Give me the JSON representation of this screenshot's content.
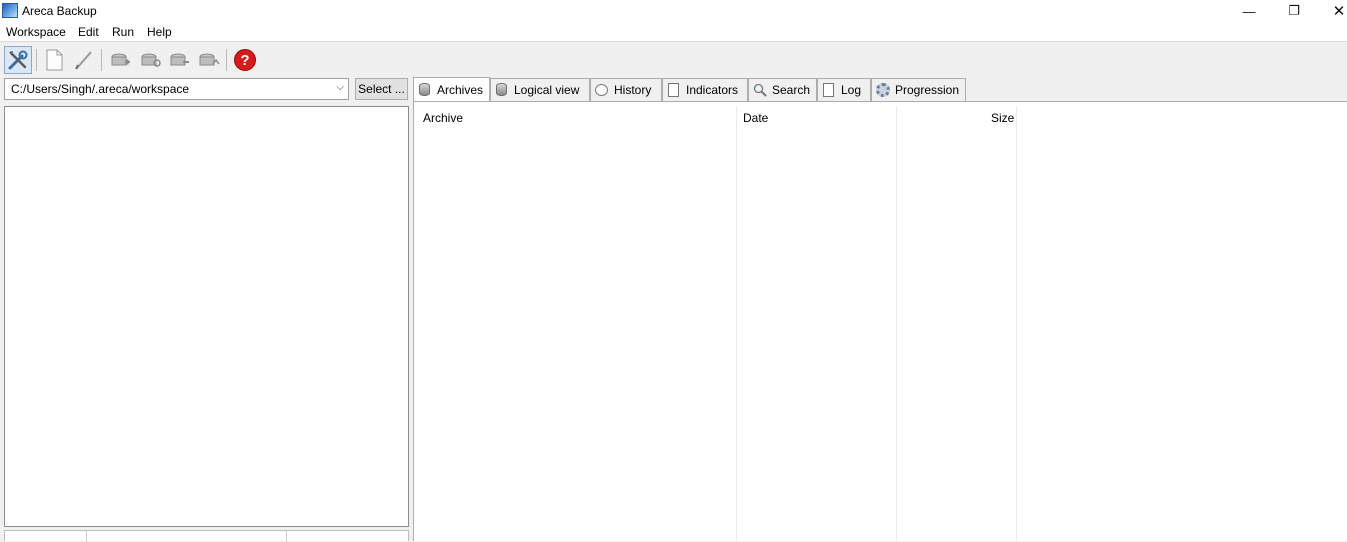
{
  "window": {
    "title": "Areca Backup",
    "minimize_glyph": "—",
    "maximize_glyph": "❐",
    "close_glyph": "✕"
  },
  "menu": {
    "items": [
      "Workspace",
      "Edit",
      "Run",
      "Help"
    ]
  },
  "toolbar": {
    "buttons": [
      "preferences-icon",
      "new-icon",
      "edit-icon",
      "backup-icon",
      "merge-icon",
      "delete-icon",
      "recover-icon",
      "help-icon"
    ]
  },
  "workspace": {
    "path": "C:/Users/Singh/.areca/workspace",
    "select_label": "Select ..."
  },
  "tabs": [
    {
      "label": "Archives",
      "icon": "database-icon"
    },
    {
      "label": "Logical view",
      "icon": "database-icon"
    },
    {
      "label": "History",
      "icon": "clock-icon"
    },
    {
      "label": "Indicators",
      "icon": "document-icon"
    },
    {
      "label": "Search",
      "icon": "magnifier-icon"
    },
    {
      "label": "Log",
      "icon": "document-icon"
    },
    {
      "label": "Progression",
      "icon": "gear-icon"
    }
  ],
  "archives_table": {
    "columns": [
      "Archive",
      "Date",
      "Size"
    ],
    "rows": []
  },
  "colors": {
    "help_red": "#d71a1a",
    "selection_blue": "#dbe7f5"
  }
}
